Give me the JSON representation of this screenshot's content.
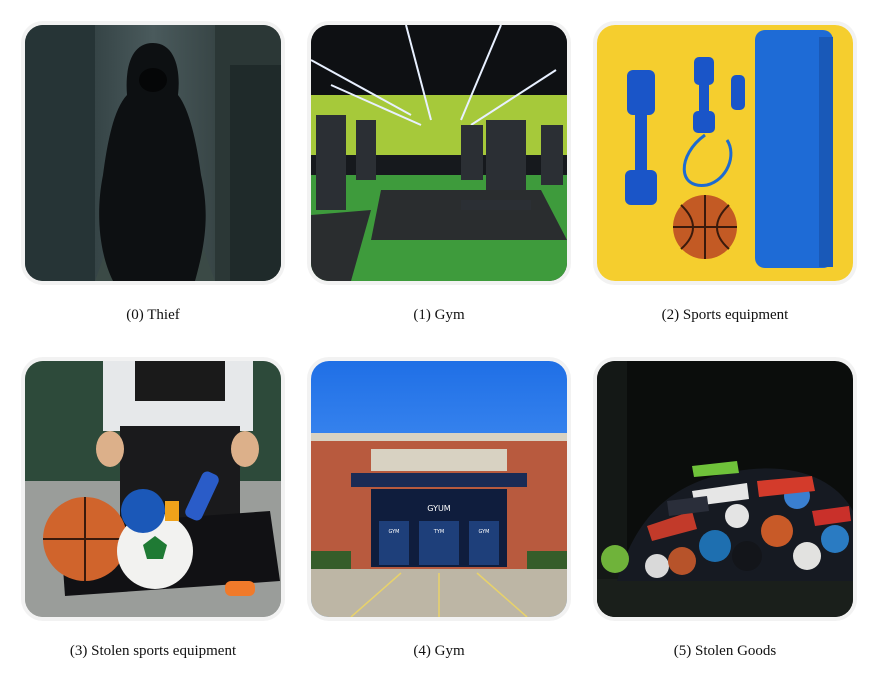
{
  "items": [
    {
      "caption": "(0) Thief",
      "subject": "hooded figure in alley"
    },
    {
      "caption": "(1) Gym",
      "subject": "gym interior with machines"
    },
    {
      "caption": "(2) Sports equipment",
      "subject": "dumbbells, jump rope, basketball, yoga mat"
    },
    {
      "caption": "(3) Stolen sports equipment",
      "subject": "person carrying bag of balls"
    },
    {
      "caption": "(4) Gym",
      "subject": "brick gym building exterior",
      "sign": "GYUM",
      "door_signs": [
        "GYM",
        "TYM",
        "GYM"
      ]
    },
    {
      "caption": "(5) Stolen Goods",
      "subject": "pile of shoes and balls in dark"
    }
  ]
}
